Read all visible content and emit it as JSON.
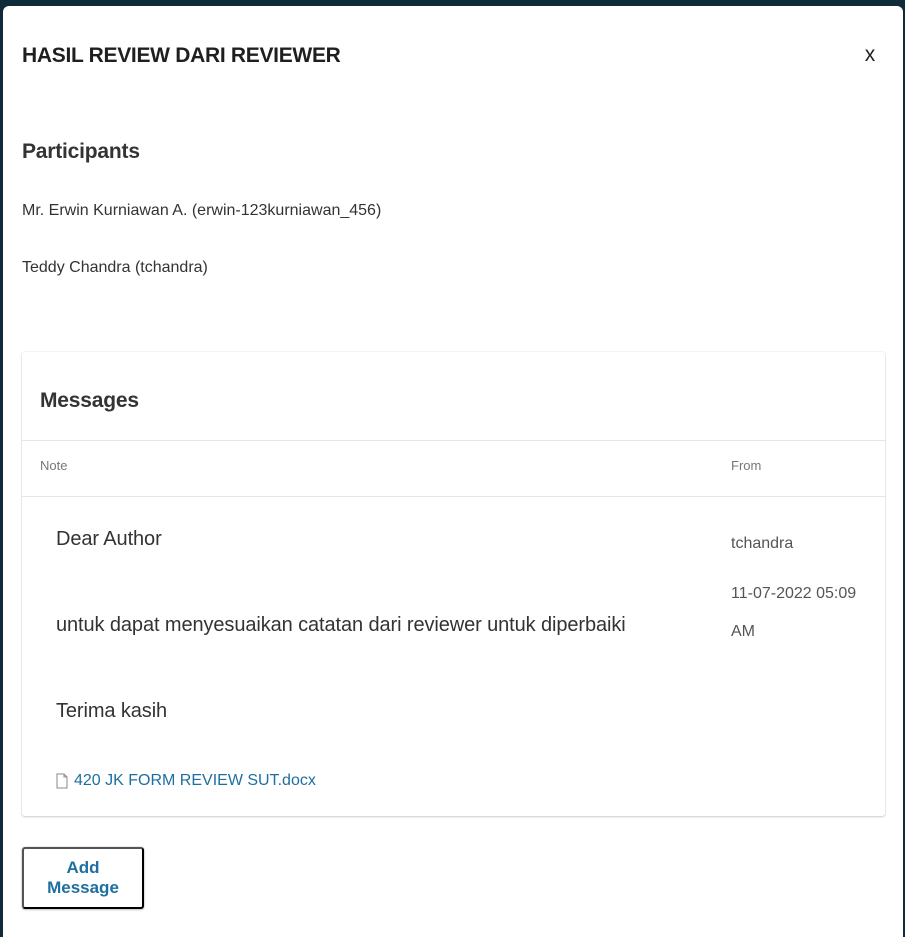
{
  "modal": {
    "title": "HASIL REVIEW DARI REVIEWER",
    "close_label": "x"
  },
  "participants": {
    "heading": "Participants",
    "items": [
      "Mr. Erwin Kurniawan A. (erwin-123kurniawan_456)",
      "Teddy Chandra (tchandra)"
    ]
  },
  "messages": {
    "heading": "Messages",
    "columns": {
      "note": "Note",
      "from": "From"
    },
    "rows": [
      {
        "note_lines": [
          "Dear Author",
          "untuk dapat menyesuaikan catatan dari reviewer untuk diperbaiki",
          "Terima kasih"
        ],
        "attachment": "420 JK FORM REVIEW SUT.docx",
        "attachment_icon": "file-icon",
        "from_user": "tchandra",
        "from_date": "11-07-2022 05:09 AM"
      }
    ]
  },
  "actions": {
    "add_message_label": "Add Message"
  },
  "colors": {
    "link": "#1e6f9f",
    "backdrop": "#0f2a38"
  }
}
